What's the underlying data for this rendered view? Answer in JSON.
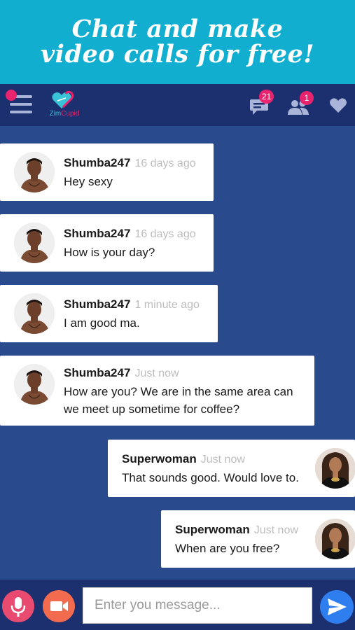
{
  "promo": {
    "line1": "Chat and make",
    "line2": "video calls for free!"
  },
  "appbar": {
    "logo_part1": "Zim",
    "logo_part2": "Cupid",
    "messages_count": "21",
    "requests_count": "1"
  },
  "messages": [
    {
      "sender": "Shumba247",
      "time": "16 days ago",
      "text": "Hey sexy"
    },
    {
      "sender": "Shumba247",
      "time": "16 days ago",
      "text": "How is your day?"
    },
    {
      "sender": "Shumba247",
      "time": "1 minute ago",
      "text": "I am good ma."
    },
    {
      "sender": "Shumba247",
      "time": "Just now",
      "text_line1": "How are you? We are in the same area can",
      "text_line2": "we meet up sometime for coffee?"
    },
    {
      "sender": "Superwoman",
      "time": "Just now",
      "text": "That sounds good. Would love to."
    },
    {
      "sender": "Superwoman",
      "time": "Just now",
      "text": "When are you free?"
    }
  ],
  "composer": {
    "placeholder": "Enter you message..."
  },
  "colors": {
    "promo_bg": "#12aed0",
    "appbar_bg": "#1c2f6e",
    "chat_bg": "#2a4a8e",
    "badge": "#e8246e",
    "mic_button": "#e94a6f",
    "video_button": "#f26b4e",
    "send_button": "#2f7ef0"
  },
  "icons": [
    "hamburger-menu-icon",
    "zimcupid-logo",
    "chat-bubble-icon",
    "users-icon",
    "heart-icon",
    "microphone-icon",
    "video-camera-icon",
    "send-icon"
  ]
}
